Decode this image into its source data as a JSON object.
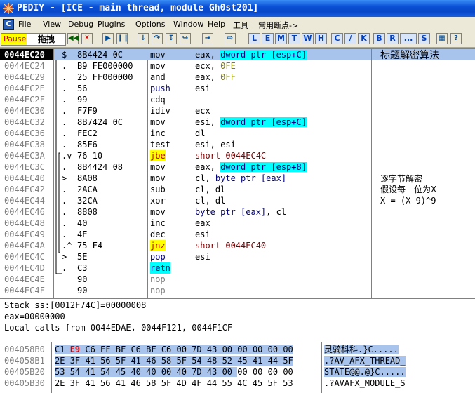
{
  "window": {
    "title": "PEDIY - [ICE - main thread, module Gh0st201]"
  },
  "menu": [
    "File",
    "View",
    "Debug",
    "Plugins",
    "Options",
    "Window",
    "Help",
    "工具",
    "常用断点->"
  ],
  "toolbar": {
    "pause_label": "Pause",
    "drag_label": "拖拽",
    "letters": [
      "L",
      "E",
      "M",
      "T",
      "W",
      "H",
      "C",
      "/",
      "K",
      "B",
      "R",
      "...",
      "S"
    ]
  },
  "cpu": {
    "rows": [
      {
        "addr": "0044EC20",
        "mark": "$",
        "hex": "8B4424 0C",
        "mn": "mov",
        "op": "eax, dword ptr [esp+C]",
        "sel": true
      },
      {
        "addr": "0044EC24",
        "mark": ".",
        "hex": "B9 FE000000",
        "mn": "mov",
        "op": "ecx, 0FE"
      },
      {
        "addr": "0044EC29",
        "mark": ".",
        "hex": "25 FF000000",
        "mn": "and",
        "op": "eax, 0FF"
      },
      {
        "addr": "0044EC2E",
        "mark": ".",
        "hex": "56",
        "mn": "push",
        "op": "esi"
      },
      {
        "addr": "0044EC2F",
        "mark": ".",
        "hex": "99",
        "mn": "cdq",
        "op": ""
      },
      {
        "addr": "0044EC30",
        "mark": ".",
        "hex": "F7F9",
        "mn": "idiv",
        "op": "ecx"
      },
      {
        "addr": "0044EC32",
        "mark": ".",
        "hex": "8B7424 0C",
        "mn": "mov",
        "op": "esi, dword ptr [esp+C]"
      },
      {
        "addr": "0044EC36",
        "mark": ".",
        "hex": "FEC2",
        "mn": "inc",
        "op": "dl"
      },
      {
        "addr": "0044EC38",
        "mark": ".",
        "hex": "85F6",
        "mn": "test",
        "op": "esi, esi"
      },
      {
        "addr": "0044EC3A",
        "mark": ".v",
        "hex": "76 10",
        "mn": "jbe",
        "op": "short 0044EC4C"
      },
      {
        "addr": "0044EC3C",
        "mark": ".",
        "hex": "8B4424 08",
        "mn": "mov",
        "op": "eax, dword ptr [esp+8]"
      },
      {
        "addr": "0044EC40",
        "mark": ">",
        "hex": "8A08",
        "mn": "mov",
        "op": "cl, byte ptr [eax]"
      },
      {
        "addr": "0044EC42",
        "mark": ".",
        "hex": "2ACA",
        "mn": "sub",
        "op": "cl, dl"
      },
      {
        "addr": "0044EC44",
        "mark": ".",
        "hex": "32CA",
        "mn": "xor",
        "op": "cl, dl"
      },
      {
        "addr": "0044EC46",
        "mark": ".",
        "hex": "8808",
        "mn": "mov",
        "op": "byte ptr [eax], cl"
      },
      {
        "addr": "0044EC48",
        "mark": ".",
        "hex": "40",
        "mn": "inc",
        "op": "eax"
      },
      {
        "addr": "0044EC49",
        "mark": ".",
        "hex": "4E",
        "mn": "dec",
        "op": "esi"
      },
      {
        "addr": "0044EC4A",
        "mark": ".^",
        "hex": "75 F4",
        "mn": "jnz",
        "op": "short 0044EC40"
      },
      {
        "addr": "0044EC4C",
        "mark": ">",
        "hex": "5E",
        "mn": "pop",
        "op": "esi"
      },
      {
        "addr": "0044EC4D",
        "mark": ".",
        "hex": "C3",
        "mn": "retn",
        "op": ""
      },
      {
        "addr": "0044EC4E",
        "mark": "",
        "hex": "90",
        "mn": "nop",
        "op": ""
      },
      {
        "addr": "0044EC4F",
        "mark": "",
        "hex": "90",
        "mn": "nop",
        "op": ""
      }
    ],
    "comments": {
      "c1": "标题解密算法",
      "c2": "逐字节解密",
      "c3": "假设每一位为X",
      "c4": "X = (X-9)^9"
    }
  },
  "info": {
    "line1": "Stack ss:[0012F74C]=00000008",
    "line2": "eax=00000000",
    "line3": "Local calls from 0044EDAE, 0044F121, 0044F1CF"
  },
  "dump": {
    "rows": [
      {
        "addr": "004058B0",
        "hex": "C1 E9 C6 EF BF C6 BF C6 00 7D 43 00 00 00 00 00",
        "ascii": "灵骑科科.}C....."
      },
      {
        "addr": "004058B10",
        "hex": "2E 3F 41 56 5F 41 46 58 5F 54 48 52 45 41 44 5F",
        "ascii": ".?AV_AFX_THREAD_"
      },
      {
        "addr": "00405B20",
        "hex": "53 54 41 54 45 40 40 00 40 7D 43 00 00 00 00 00",
        "ascii": "STATE@@.@}C....."
      },
      {
        "addr": "00405B30",
        "hex": "2E 3F 41 56 41 46 58 5F 4D 4F 44 55 4C 45 5F 53",
        "ascii": ".?AVAFX_MODULE_S"
      }
    ]
  },
  "colors": {
    "accent": "#0a246a",
    "cyan": "#00ffff",
    "yellow": "#ffff00",
    "num": "#808000",
    "kw_blue": "#000080"
  }
}
